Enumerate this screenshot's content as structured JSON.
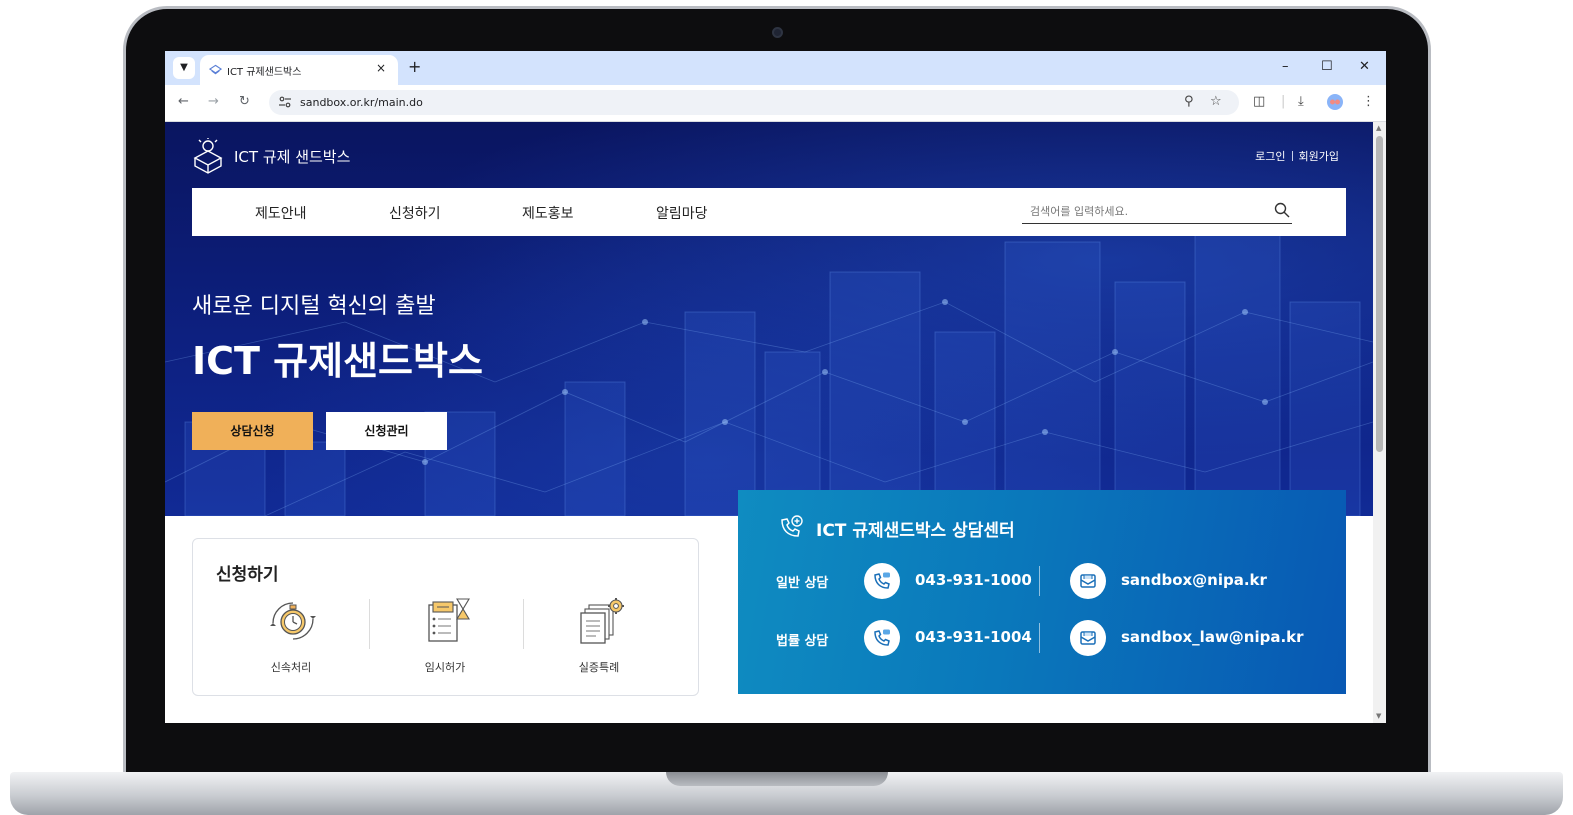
{
  "browser": {
    "tab_title": "ICT 규제샌드박스",
    "tab_close": "×",
    "new_tab": "+",
    "url": "sandbox.or.kr/main.do",
    "icons": [
      "tab-menu-icon",
      "favicon-icon",
      "back-icon",
      "forward-icon",
      "reload-icon",
      "site-info-icon",
      "zoom-icon",
      "star-icon",
      "extensions-icon",
      "download-icon",
      "profile-icon",
      "menu-icon"
    ]
  },
  "header": {
    "logo_text": "ICT 규제 샌드박스",
    "login": "로그인",
    "signup": "회원가입"
  },
  "gnb": {
    "items": [
      "제도안내",
      "신청하기",
      "제도홍보",
      "알림마당"
    ],
    "search_placeholder": "검색어를 입력하세요."
  },
  "hero": {
    "subtitle": "새로운 디지털 혁신의 출발",
    "title": "ICT 규제샌드박스",
    "btn_consult": "상담신청",
    "btn_manage": "신청관리"
  },
  "apply": {
    "title": "신청하기",
    "items": [
      "신속처리",
      "임시허가",
      "실증특례"
    ]
  },
  "center": {
    "title": "ICT 규제샌드박스 상담센터",
    "rows": [
      {
        "label": "일반 상담",
        "phone": "043-931-1000",
        "email": "sandbox@nipa.kr"
      },
      {
        "label": "법률 상담",
        "phone": "043-931-1004",
        "email": "sandbox_law@nipa.kr"
      }
    ]
  },
  "colors": {
    "hero_bg": "#0d2080",
    "gnb_bg": "#ffffff",
    "consult_btn": "#f0b059",
    "center_start": "#0f8cc1",
    "center_end": "#0858b3",
    "tabstrip": "#d3e3fd"
  }
}
